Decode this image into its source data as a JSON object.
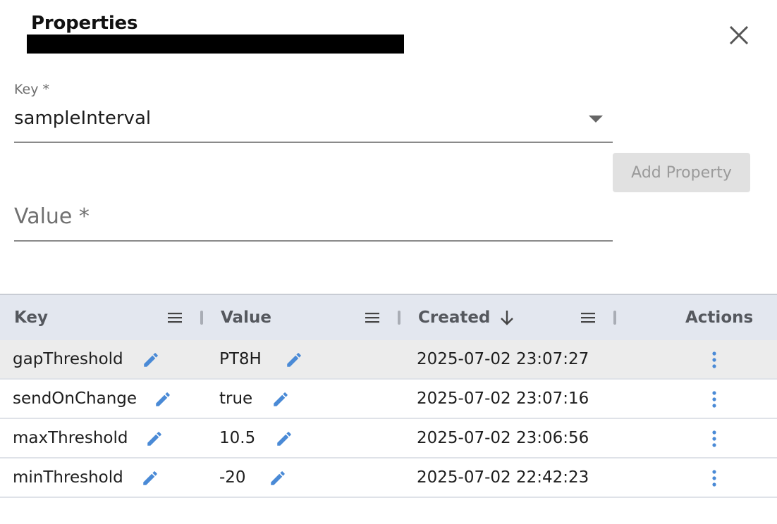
{
  "dialog": {
    "title": "Properties",
    "close_icon": "close-icon"
  },
  "form": {
    "key_label": "Key *",
    "key_value": "sampleInterval",
    "value_placeholder": "Value *",
    "add_button_label": "Add Property"
  },
  "table": {
    "columns": [
      {
        "label": "Key"
      },
      {
        "label": "Value"
      },
      {
        "label": "Created",
        "sort": "descending"
      },
      {
        "label": "Actions"
      }
    ],
    "rows": [
      {
        "key": "gapThreshold",
        "value": "PT8H",
        "created": "2025-07-02 23:07:27"
      },
      {
        "key": "sendOnChange",
        "value": "true",
        "created": "2025-07-02 23:07:16"
      },
      {
        "key": "maxThreshold",
        "value": "10.5",
        "created": "2025-07-02 23:06:56"
      },
      {
        "key": "minThreshold",
        "value": "-20",
        "created": "2025-07-02 22:42:23"
      }
    ]
  },
  "colors": {
    "accent": "#4a8ad6",
    "header_bg": "#e3e7ef",
    "selected_row_bg": "#ececec"
  }
}
